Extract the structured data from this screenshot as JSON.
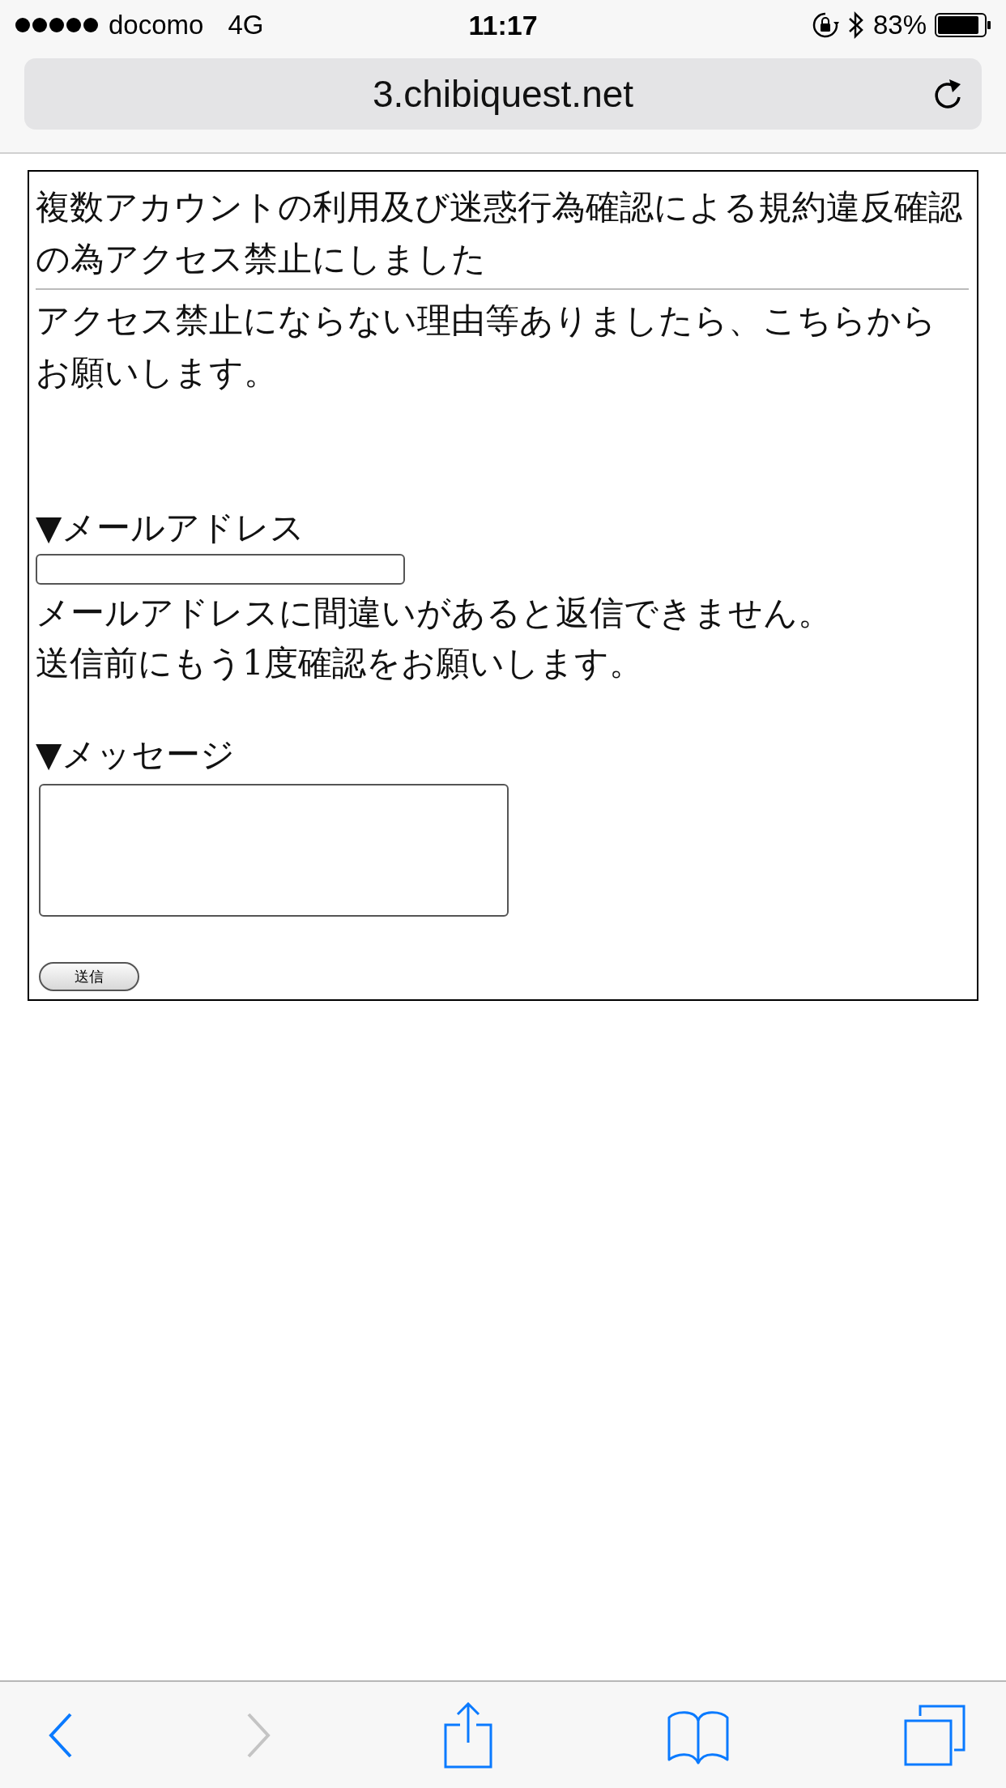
{
  "status_bar": {
    "carrier": "docomo",
    "network": "4G",
    "time": "11:17",
    "battery": "83%"
  },
  "address_bar": {
    "url": "3.chibiquest.net"
  },
  "page": {
    "title": "複数アカウントの利用及び迷惑行為確認による規約違反確認の為アクセス禁止にしました",
    "notice": "アクセス禁止にならない理由等ありましたら、こちらからお願いします。",
    "fields": [
      {
        "kind": "input",
        "label": "▼メールアドレス",
        "notes": [
          "メールアドレスに間違いがあると返信できません。",
          "送信前にもう1度確認をお願いします。"
        ]
      },
      {
        "kind": "textarea",
        "label": "▼メッセージ"
      }
    ],
    "submit": "送信"
  },
  "toolbar": [
    {
      "kind": "back",
      "disabled": false
    },
    {
      "kind": "forward",
      "disabled": true
    },
    {
      "kind": "share",
      "disabled": false
    },
    {
      "kind": "bookmarks",
      "disabled": false
    },
    {
      "kind": "tabs",
      "disabled": false
    }
  ]
}
